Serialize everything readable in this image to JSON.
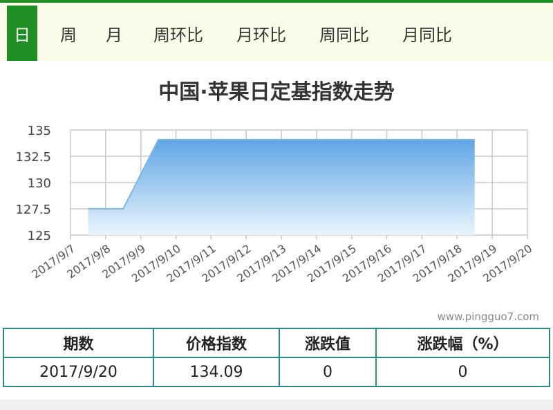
{
  "tabs": [
    {
      "label": "日",
      "active": true
    },
    {
      "label": "周",
      "active": false
    },
    {
      "label": "月",
      "active": false
    },
    {
      "label": "周环比",
      "active": false
    },
    {
      "label": "月环比",
      "active": false
    },
    {
      "label": "周同比",
      "active": false
    },
    {
      "label": "月同比",
      "active": false
    }
  ],
  "colors": {
    "accent": "#1f8f24",
    "area_top": "#6aaee8",
    "area_line": "#7cb6e6",
    "table_border": "#2a8a8a"
  },
  "chart_data": {
    "type": "area",
    "title": "中国·苹果日定基指数走势",
    "xlabel": "",
    "ylabel": "",
    "x": [
      "2017/9/7",
      "2017/9/8",
      "2017/9/9",
      "2017/9/10",
      "2017/9/11",
      "2017/9/12",
      "2017/9/13",
      "2017/9/14",
      "2017/9/15",
      "2017/9/16",
      "2017/9/17",
      "2017/9/18",
      "2017/9/19",
      "2017/9/20"
    ],
    "series": [
      {
        "values": [
          127.5,
          127.5,
          134.09,
          134.09,
          134.09,
          134.09,
          134.09,
          134.09,
          134.09,
          134.09,
          134.09,
          134.09,
          null,
          null
        ]
      }
    ],
    "yticks": [
      "135",
      "132.5",
      "130",
      "127.5",
      "125"
    ],
    "ylim": [
      125,
      135
    ],
    "grid": true
  },
  "watermark": "www.pingguo7.com",
  "table": {
    "headers": [
      "期数",
      "价格指数",
      "涨跌值",
      "涨跌幅（%）"
    ],
    "row": [
      "2017/9/20",
      "134.09",
      "0",
      "0"
    ]
  }
}
